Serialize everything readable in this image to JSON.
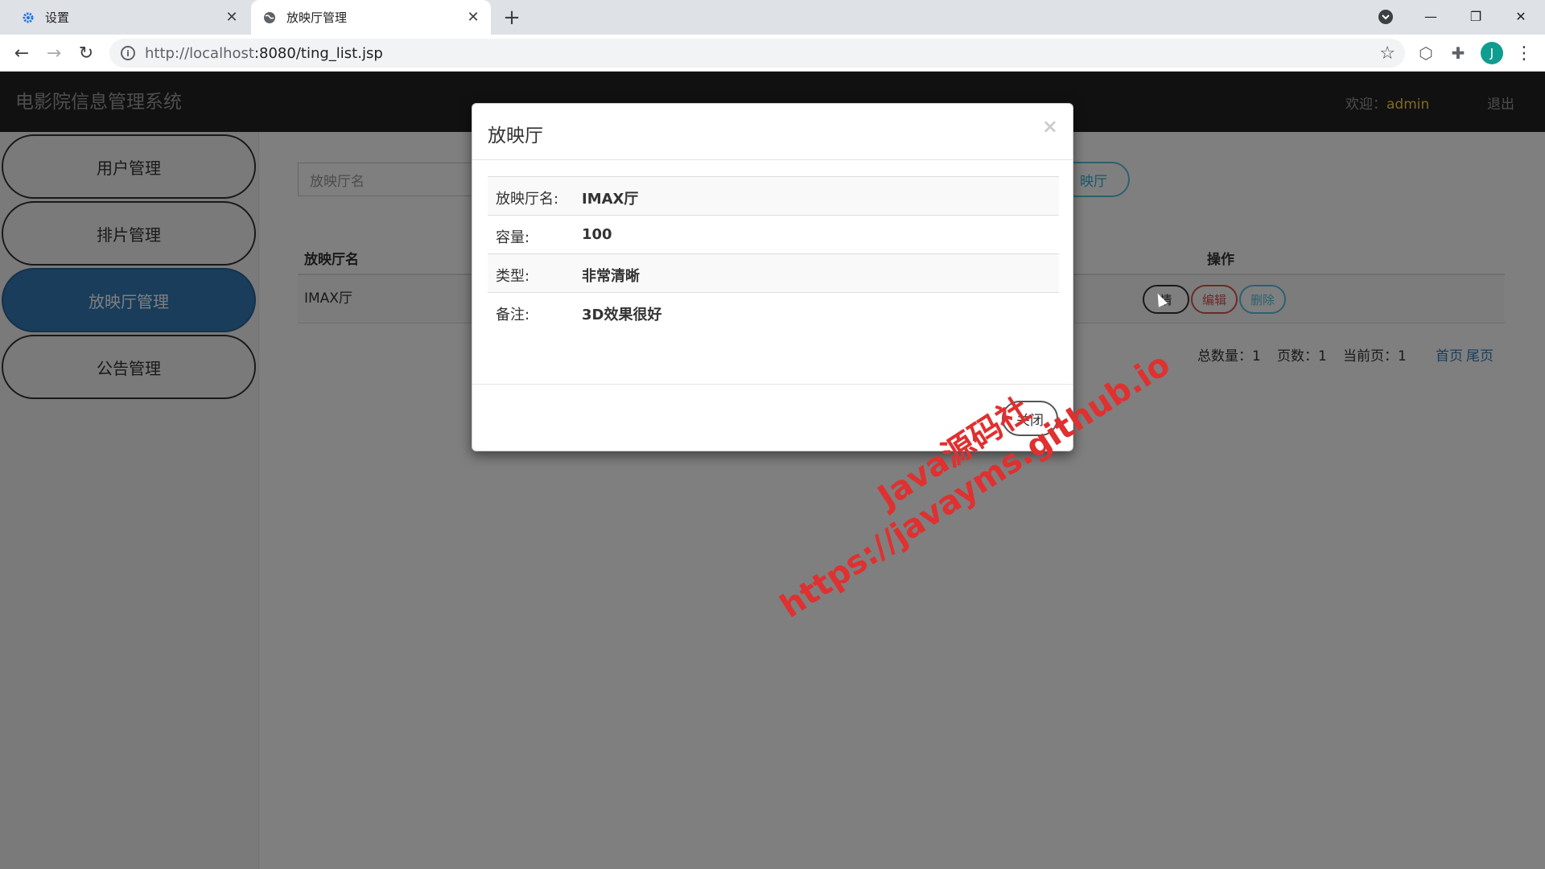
{
  "browser": {
    "tabs": [
      {
        "title": "设置",
        "icon": "gear-icon",
        "active": false
      },
      {
        "title": "放映厅管理",
        "icon": "globe-icon",
        "active": true
      }
    ],
    "new_tab": "+",
    "url_host": "http://localhost",
    "url_rest": ":8080/ting_list.jsp",
    "avatar_initial": "J"
  },
  "app": {
    "title": "电影院信息管理系统",
    "welcome_label": "欢迎：",
    "username": "admin",
    "logout": "退出"
  },
  "sidebar": {
    "items": [
      {
        "label": "用户管理",
        "active": false
      },
      {
        "label": "排片管理",
        "active": false
      },
      {
        "label": "放映厅管理",
        "active": true
      },
      {
        "label": "公告管理",
        "active": false
      }
    ]
  },
  "main": {
    "search_placeholder": "放映厅名",
    "add_button": "添加放映厅",
    "add_button_visible": "映厅",
    "table": {
      "headers": {
        "name": "放映厅名",
        "actions": "操作"
      },
      "rows": [
        {
          "name": "IMAX厅",
          "detail": "详情",
          "detail_visible": "情",
          "edit": "编辑",
          "delete": "删除"
        }
      ]
    },
    "pagination": {
      "total": "总数量：1",
      "pages": "页数：1",
      "current": "当前页：1",
      "first": "首页",
      "last": "尾页"
    }
  },
  "modal": {
    "title": "放映厅",
    "close_x": "×",
    "fields": [
      {
        "label": "放映厅名:",
        "value": "IMAX厅"
      },
      {
        "label": "容量:",
        "value": "100"
      },
      {
        "label": "类型:",
        "value": "非常清晰"
      },
      {
        "label": "备注:",
        "value": "3D效果很好"
      }
    ],
    "close_button": "关闭"
  },
  "watermark": {
    "line1": "Java源码社",
    "line2": "https://javayms.github.io"
  },
  "colors": {
    "header_bg": "#222222",
    "active_nav": "#337ab7",
    "username": "#ffd34e",
    "watermark": "#e03030"
  }
}
